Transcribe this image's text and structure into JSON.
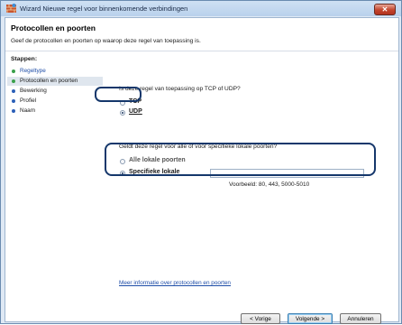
{
  "window": {
    "title": "Wizard Nieuwe regel voor binnenkomende verbindingen",
    "close_glyph": "✕"
  },
  "header": {
    "title": "Protocollen en poorten",
    "subtitle": "Geef de protocollen en poorten op waarop deze regel van toepassing is."
  },
  "steps": {
    "title": "Stappen:",
    "items": [
      {
        "label": "Regeltype",
        "state": "done"
      },
      {
        "label": "Protocollen en poorten",
        "state": "active"
      },
      {
        "label": "Bewerking",
        "state": "pending"
      },
      {
        "label": "Profiel",
        "state": "pending"
      },
      {
        "label": "Naam",
        "state": "pending"
      }
    ]
  },
  "protocol": {
    "question": "Is deze regel van toepassing op TCP of UDP?",
    "options": [
      {
        "label": "TCP",
        "selected": false
      },
      {
        "label": "UDP",
        "selected": true
      }
    ]
  },
  "ports": {
    "question": "Geldt deze regel voor alle of voor specifieke lokale poorten?",
    "options": [
      {
        "label": "Alle lokale poorten",
        "selected": false
      },
      {
        "label": "Specifieke lokale",
        "selected": true
      }
    ],
    "input_value": "",
    "example": "Voorbeeld: 80, 443, 5000-5010"
  },
  "help_link": "Meer informatie over protocollen en poorten",
  "buttons": {
    "back": "< Vorige",
    "next": "Volgende >",
    "cancel": "Annuleren"
  },
  "colors": {
    "done_dot": "#3aa04b",
    "pending_dot": "#2b5fb8",
    "highlight": "#15376b",
    "link": "#1f4ea8"
  }
}
